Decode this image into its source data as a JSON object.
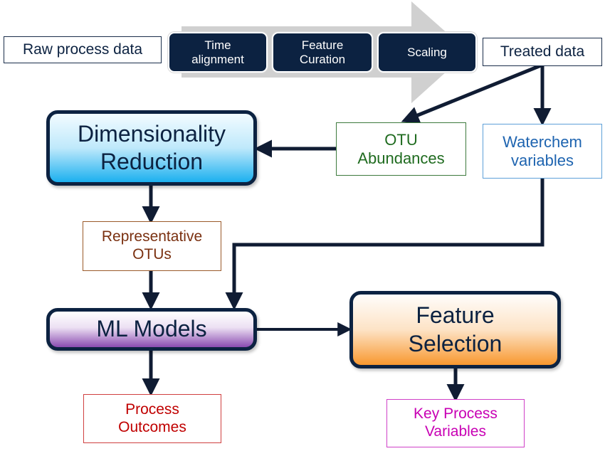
{
  "diagram": {
    "type": "flowchart",
    "pipeline": {
      "input": "Raw process data",
      "steps": [
        {
          "label": "Time\nalignment"
        },
        {
          "label": "Feature\nCuration"
        },
        {
          "label": "Scaling"
        }
      ],
      "output": "Treated data",
      "colors": {
        "step_fill": "#0c2241",
        "arrow": "#d0d0d0"
      }
    },
    "nodes": {
      "otu_abundances": {
        "label": "OTU\nAbundances",
        "color": "#1f6b1f"
      },
      "waterchem_variables": {
        "label": "Waterchem\nvariables",
        "color": "#1e64b0"
      },
      "dimensionality_reduction": {
        "label": "Dimensionality\nReduction",
        "gradient": [
          "#e8f7fe",
          "#1bb0ef"
        ]
      },
      "representative_otus": {
        "label": "Representative\nOTUs",
        "color": "#7a3010"
      },
      "ml_models": {
        "label": "ML Models",
        "gradient": [
          "#ffffff",
          "#8a4bb0"
        ]
      },
      "feature_selection": {
        "label": "Feature\nSelection",
        "gradient": [
          "#fffaf5",
          "#f8982f"
        ]
      },
      "process_outcomes": {
        "label": "Process\nOutcomes",
        "color": "#c00000"
      },
      "key_process_variables": {
        "label": "Key Process\nVariables",
        "color": "#c800b4"
      }
    },
    "edges": [
      {
        "from": "Treated data",
        "to": "OTU Abundances"
      },
      {
        "from": "Treated data",
        "to": "Waterchem variables"
      },
      {
        "from": "OTU Abundances",
        "to": "Dimensionality Reduction"
      },
      {
        "from": "Dimensionality Reduction",
        "to": "Representative OTUs"
      },
      {
        "from": "Representative OTUs",
        "to": "ML Models"
      },
      {
        "from": "Waterchem variables",
        "to": "ML Models"
      },
      {
        "from": "ML Models",
        "to": "Feature Selection"
      },
      {
        "from": "ML Models",
        "to": "Process Outcomes"
      },
      {
        "from": "Feature Selection",
        "to": "Key Process Variables"
      }
    ],
    "connector_color": "#101c33"
  }
}
